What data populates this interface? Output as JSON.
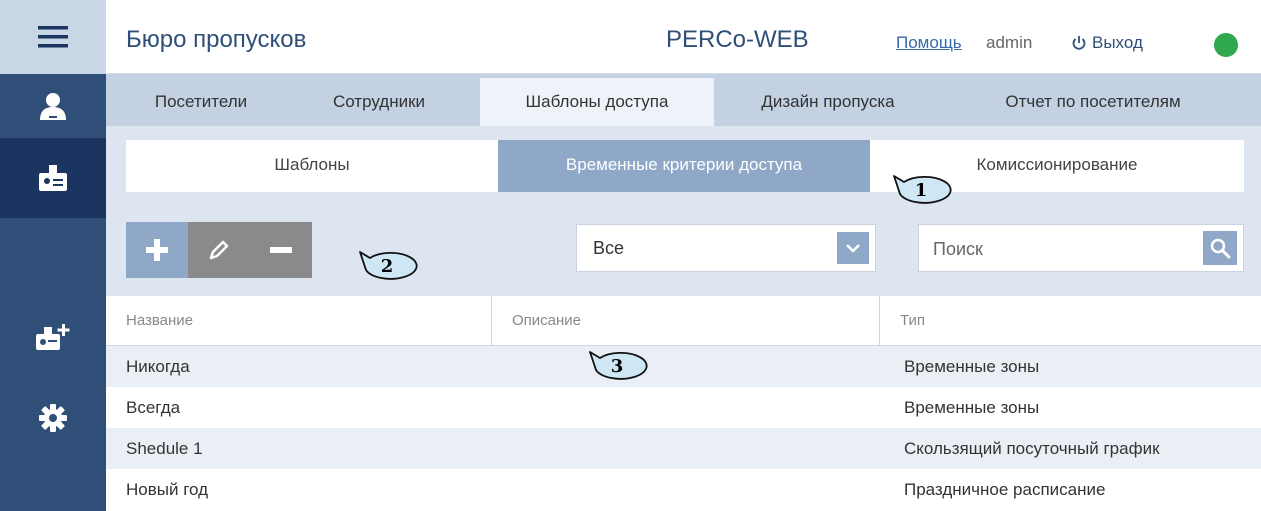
{
  "sidebar": {
    "items": [
      {
        "icon": "hamburger-menu-icon"
      },
      {
        "icon": "visitor-icon"
      },
      {
        "icon": "pass-bureau-icon"
      },
      {
        "icon": "search-icon"
      },
      {
        "icon": "add-card-icon"
      },
      {
        "icon": "gear-icon"
      }
    ],
    "colors": {
      "bg": "#2f4f79",
      "active": "#1b3560",
      "menu": "#c9d6e6"
    }
  },
  "header": {
    "title": "Бюро пропусков",
    "brand": "PERCo-WEB",
    "help": "Помощь",
    "user": "admin",
    "logout": "Выход",
    "status_color": "#2fa84f"
  },
  "tabs": [
    {
      "label": "Посетители",
      "active": false
    },
    {
      "label": "Сотрудники",
      "active": false
    },
    {
      "label": "Шаблоны доступа",
      "active": true
    },
    {
      "label": "Дизайн пропуска",
      "active": false
    },
    {
      "label": "Отчет по посетителям",
      "active": false
    }
  ],
  "subtabs": [
    {
      "label": "Шаблоны",
      "active": false
    },
    {
      "label": "Временные критерии доступа",
      "active": true
    },
    {
      "label": "Комиссионирование",
      "active": false
    }
  ],
  "toolbar": {
    "add_icon": "plus-icon",
    "edit_icon": "pencil-icon",
    "delete_icon": "minus-icon"
  },
  "filter": {
    "value": "Все"
  },
  "search": {
    "placeholder": "Поиск"
  },
  "table": {
    "columns": [
      "Название",
      "Описание",
      "Тип"
    ],
    "rows": [
      {
        "name": "Никогда",
        "description": "",
        "type": "Временные зоны"
      },
      {
        "name": "Всегда",
        "description": "",
        "type": "Временные зоны"
      },
      {
        "name": "Shedule 1",
        "description": "",
        "type": "Скользящий посуточный график"
      },
      {
        "name": "Новый год",
        "description": "",
        "type": "Праздничное расписание"
      }
    ]
  },
  "callouts": [
    "1",
    "2",
    "3"
  ]
}
